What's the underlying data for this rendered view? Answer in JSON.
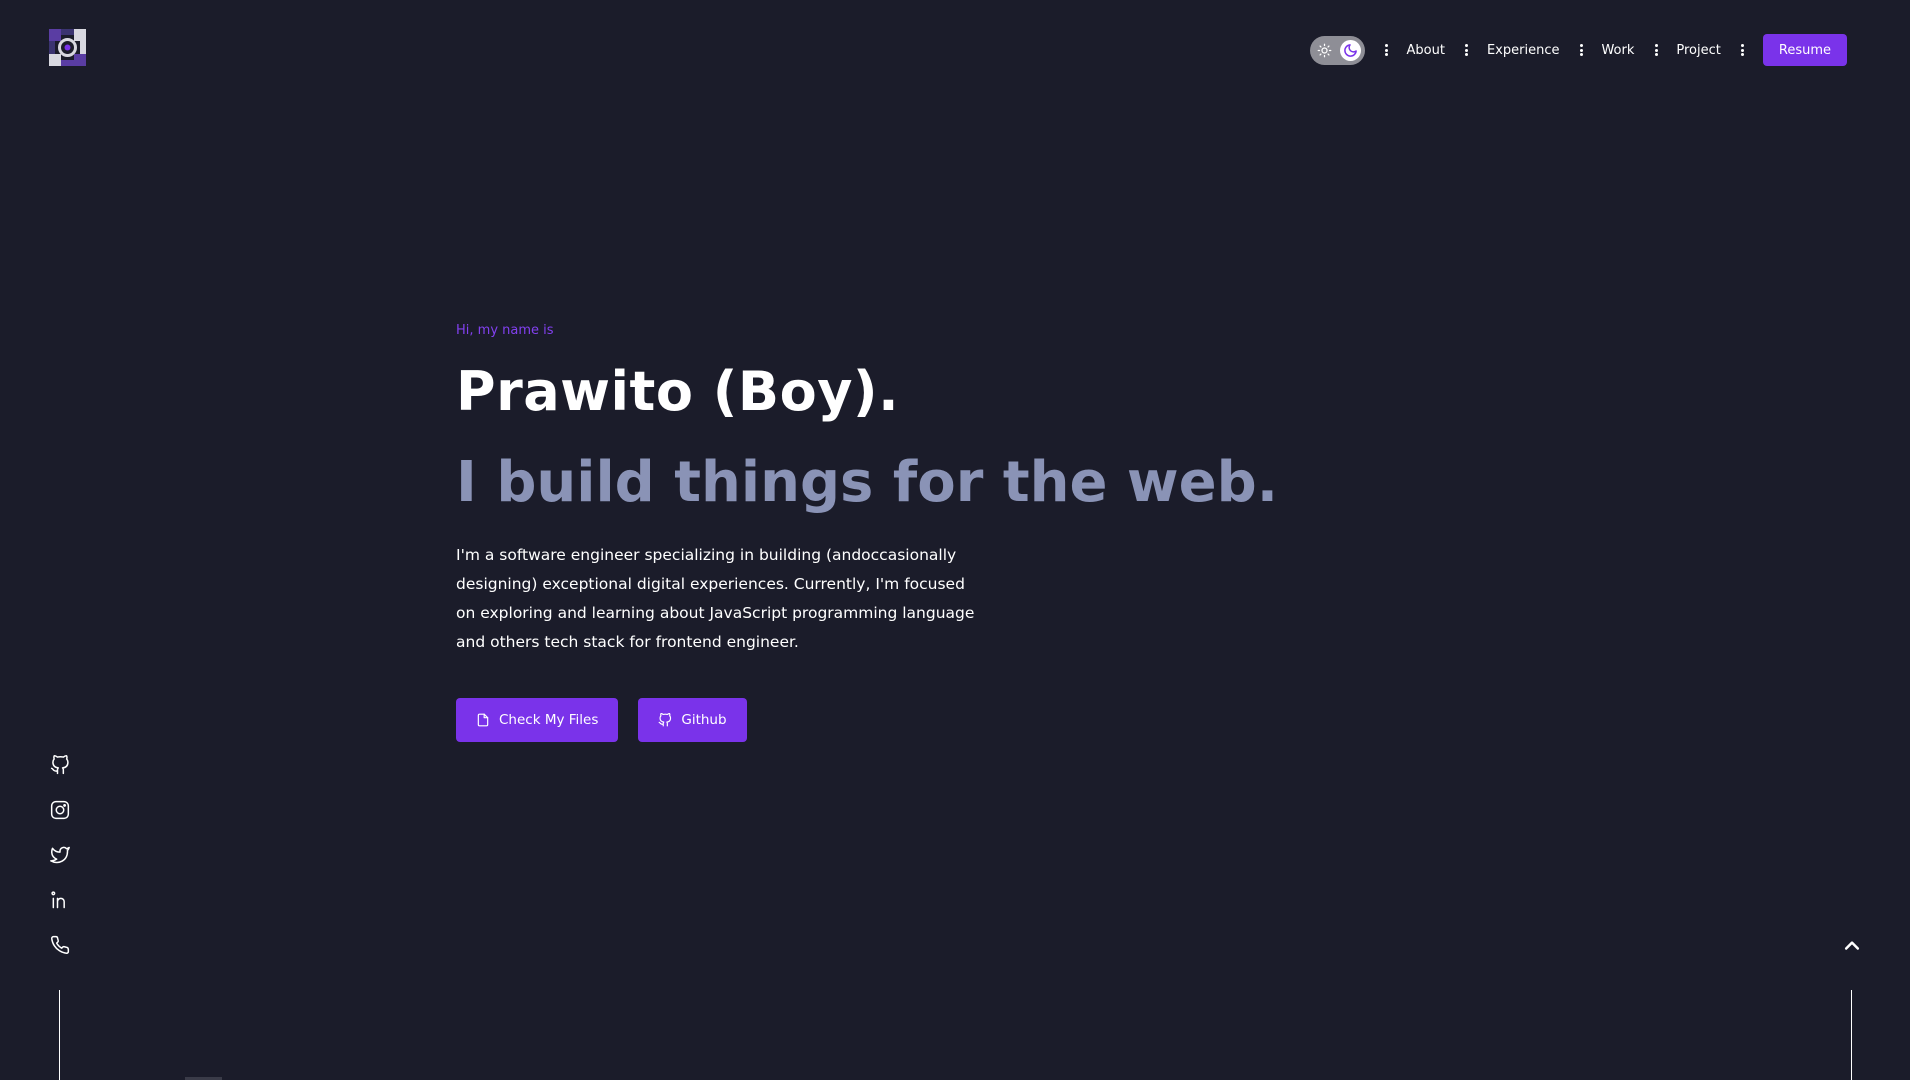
{
  "brand": {
    "logo_icon": "monogram-logo-icon"
  },
  "nav": {
    "theme_toggle": {
      "light_icon": "sun-icon",
      "dark_icon": "moon-icon",
      "active": "dark"
    },
    "items": [
      {
        "label": "About"
      },
      {
        "label": "Experience"
      },
      {
        "label": "Work"
      },
      {
        "label": "Project"
      }
    ],
    "resume_label": "Resume"
  },
  "hero": {
    "greeting": "Hi, my name is",
    "name": "Prawito (Boy).",
    "tagline": "I build things for the web.",
    "bio": "I'm a software engineer specializing in building (andoccasionally designing) exceptional digital experiences. Currently, I'm focused on exploring and learning about JavaScript programming language and others tech stack for frontend engineer.",
    "buttons": {
      "files_label": "Check My Files",
      "files_icon": "file-icon",
      "github_label": "Github",
      "github_icon": "github-icon"
    }
  },
  "socials": [
    {
      "icon": "github-icon"
    },
    {
      "icon": "instagram-icon"
    },
    {
      "icon": "twitter-icon"
    },
    {
      "icon": "linkedin-icon"
    },
    {
      "icon": "phone-icon"
    }
  ],
  "scroll_top": {
    "icon": "chevron-up-icon"
  },
  "colors": {
    "background": "#1b1c2a",
    "accent": "#7a33ea",
    "greeting": "#8240ef",
    "tagline": "#8a93b6",
    "text": "#ffffff"
  }
}
